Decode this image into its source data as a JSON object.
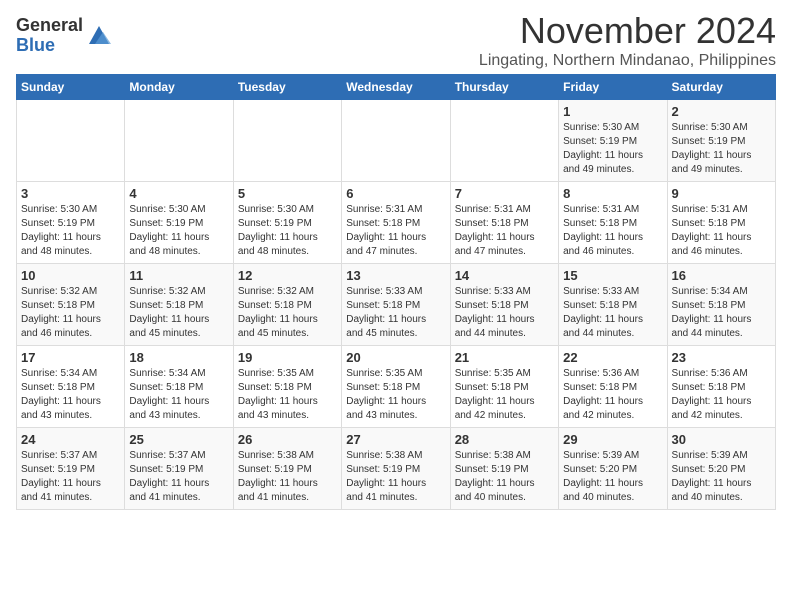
{
  "logo": {
    "general": "General",
    "blue": "Blue"
  },
  "header": {
    "month": "November 2024",
    "location": "Lingating, Northern Mindanao, Philippines"
  },
  "weekdays": [
    "Sunday",
    "Monday",
    "Tuesday",
    "Wednesday",
    "Thursday",
    "Friday",
    "Saturday"
  ],
  "weeks": [
    [
      {
        "day": "",
        "info": ""
      },
      {
        "day": "",
        "info": ""
      },
      {
        "day": "",
        "info": ""
      },
      {
        "day": "",
        "info": ""
      },
      {
        "day": "",
        "info": ""
      },
      {
        "day": "1",
        "info": "Sunrise: 5:30 AM\nSunset: 5:19 PM\nDaylight: 11 hours\nand 49 minutes."
      },
      {
        "day": "2",
        "info": "Sunrise: 5:30 AM\nSunset: 5:19 PM\nDaylight: 11 hours\nand 49 minutes."
      }
    ],
    [
      {
        "day": "3",
        "info": "Sunrise: 5:30 AM\nSunset: 5:19 PM\nDaylight: 11 hours\nand 48 minutes."
      },
      {
        "day": "4",
        "info": "Sunrise: 5:30 AM\nSunset: 5:19 PM\nDaylight: 11 hours\nand 48 minutes."
      },
      {
        "day": "5",
        "info": "Sunrise: 5:30 AM\nSunset: 5:19 PM\nDaylight: 11 hours\nand 48 minutes."
      },
      {
        "day": "6",
        "info": "Sunrise: 5:31 AM\nSunset: 5:18 PM\nDaylight: 11 hours\nand 47 minutes."
      },
      {
        "day": "7",
        "info": "Sunrise: 5:31 AM\nSunset: 5:18 PM\nDaylight: 11 hours\nand 47 minutes."
      },
      {
        "day": "8",
        "info": "Sunrise: 5:31 AM\nSunset: 5:18 PM\nDaylight: 11 hours\nand 46 minutes."
      },
      {
        "day": "9",
        "info": "Sunrise: 5:31 AM\nSunset: 5:18 PM\nDaylight: 11 hours\nand 46 minutes."
      }
    ],
    [
      {
        "day": "10",
        "info": "Sunrise: 5:32 AM\nSunset: 5:18 PM\nDaylight: 11 hours\nand 46 minutes."
      },
      {
        "day": "11",
        "info": "Sunrise: 5:32 AM\nSunset: 5:18 PM\nDaylight: 11 hours\nand 45 minutes."
      },
      {
        "day": "12",
        "info": "Sunrise: 5:32 AM\nSunset: 5:18 PM\nDaylight: 11 hours\nand 45 minutes."
      },
      {
        "day": "13",
        "info": "Sunrise: 5:33 AM\nSunset: 5:18 PM\nDaylight: 11 hours\nand 45 minutes."
      },
      {
        "day": "14",
        "info": "Sunrise: 5:33 AM\nSunset: 5:18 PM\nDaylight: 11 hours\nand 44 minutes."
      },
      {
        "day": "15",
        "info": "Sunrise: 5:33 AM\nSunset: 5:18 PM\nDaylight: 11 hours\nand 44 minutes."
      },
      {
        "day": "16",
        "info": "Sunrise: 5:34 AM\nSunset: 5:18 PM\nDaylight: 11 hours\nand 44 minutes."
      }
    ],
    [
      {
        "day": "17",
        "info": "Sunrise: 5:34 AM\nSunset: 5:18 PM\nDaylight: 11 hours\nand 43 minutes."
      },
      {
        "day": "18",
        "info": "Sunrise: 5:34 AM\nSunset: 5:18 PM\nDaylight: 11 hours\nand 43 minutes."
      },
      {
        "day": "19",
        "info": "Sunrise: 5:35 AM\nSunset: 5:18 PM\nDaylight: 11 hours\nand 43 minutes."
      },
      {
        "day": "20",
        "info": "Sunrise: 5:35 AM\nSunset: 5:18 PM\nDaylight: 11 hours\nand 43 minutes."
      },
      {
        "day": "21",
        "info": "Sunrise: 5:35 AM\nSunset: 5:18 PM\nDaylight: 11 hours\nand 42 minutes."
      },
      {
        "day": "22",
        "info": "Sunrise: 5:36 AM\nSunset: 5:18 PM\nDaylight: 11 hours\nand 42 minutes."
      },
      {
        "day": "23",
        "info": "Sunrise: 5:36 AM\nSunset: 5:18 PM\nDaylight: 11 hours\nand 42 minutes."
      }
    ],
    [
      {
        "day": "24",
        "info": "Sunrise: 5:37 AM\nSunset: 5:19 PM\nDaylight: 11 hours\nand 41 minutes."
      },
      {
        "day": "25",
        "info": "Sunrise: 5:37 AM\nSunset: 5:19 PM\nDaylight: 11 hours\nand 41 minutes."
      },
      {
        "day": "26",
        "info": "Sunrise: 5:38 AM\nSunset: 5:19 PM\nDaylight: 11 hours\nand 41 minutes."
      },
      {
        "day": "27",
        "info": "Sunrise: 5:38 AM\nSunset: 5:19 PM\nDaylight: 11 hours\nand 41 minutes."
      },
      {
        "day": "28",
        "info": "Sunrise: 5:38 AM\nSunset: 5:19 PM\nDaylight: 11 hours\nand 40 minutes."
      },
      {
        "day": "29",
        "info": "Sunrise: 5:39 AM\nSunset: 5:20 PM\nDaylight: 11 hours\nand 40 minutes."
      },
      {
        "day": "30",
        "info": "Sunrise: 5:39 AM\nSunset: 5:20 PM\nDaylight: 11 hours\nand 40 minutes."
      }
    ]
  ]
}
